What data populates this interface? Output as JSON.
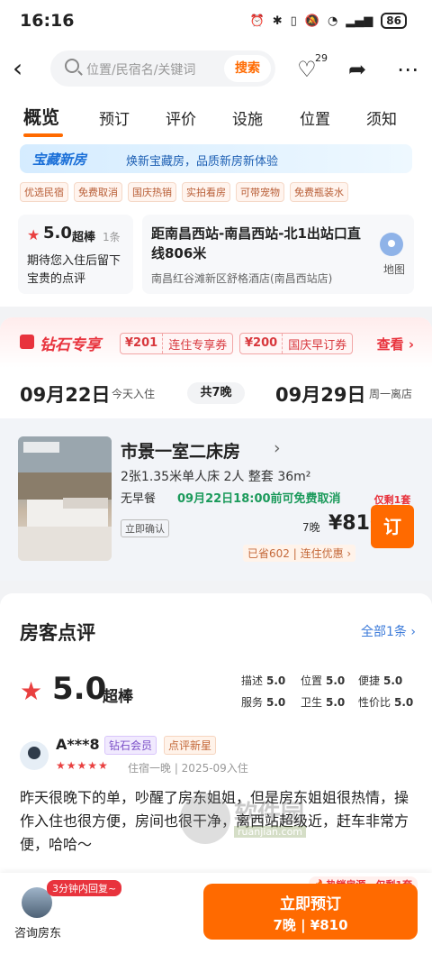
{
  "status_bar": {
    "time": "16:16",
    "battery": "86",
    "icons": [
      "alarm-icon",
      "bluetooth-icon",
      "vibrate-icon",
      "mute-icon",
      "wifi-icon",
      "signal-icon"
    ]
  },
  "header": {
    "search_placeholder": "位置/民宿名/关键词",
    "search_button": "搜索",
    "favorite_count": "29"
  },
  "tabs": [
    "概览",
    "预订",
    "评价",
    "设施",
    "位置",
    "须知"
  ],
  "promo": {
    "title": "宝藏新房",
    "subtitle": "焕新宝藏房，品质新房新体验"
  },
  "tags": [
    "优选民宿",
    "免费取消",
    "国庆热销",
    "实拍看房",
    "可带宠物",
    "免费瓶装水"
  ],
  "rating_card": {
    "score": "5.0",
    "label": "超棒",
    "count": "1条",
    "tip": "期待您入住后留下宝贵的点评"
  },
  "location_card": {
    "distance": "距南昌西站-南昌西站-北1出站口直线806米",
    "address": "南昌红谷滩新区舒格酒店(南昌西站店)",
    "map_label": "地图"
  },
  "diamond": {
    "title": "钻石专享",
    "coupons": [
      {
        "amount": "¥201",
        "name": "连住专享券"
      },
      {
        "amount": "¥200",
        "name": "国庆早订券"
      }
    ],
    "more": "查看"
  },
  "dates": {
    "checkin": "09月22日",
    "checkin_sub": "今天入住",
    "nights": "共7晚",
    "checkout": "09月29日",
    "checkout_sub": "周一离店"
  },
  "room": {
    "name": "市景一室二床房",
    "spec": "2张1.35米单人床 2人 整套 36m²",
    "breakfast": "无早餐",
    "cancel": "09月22日18:00前可免费取消",
    "confirm": "立即确认",
    "price_prefix": "7晚",
    "price": "¥810",
    "saved": "已省602 | 连住优惠",
    "remaining": "仅剩1套",
    "book": "订"
  },
  "reviews": {
    "heading": "房客点评",
    "all": "全部1条",
    "score": "5.0",
    "label": "超棒",
    "sub_scores": [
      {
        "name": "描述",
        "value": "5.0"
      },
      {
        "name": "位置",
        "value": "5.0"
      },
      {
        "name": "便捷",
        "value": "5.0"
      },
      {
        "name": "服务",
        "value": "5.0"
      },
      {
        "name": "卫生",
        "value": "5.0"
      },
      {
        "name": "性价比",
        "value": "5.0"
      }
    ],
    "item": {
      "user": "A***8",
      "badge1": "钻石会员",
      "badge2": "点评新星",
      "stars": 5,
      "stay": "住宿一晚 | 2025-09入住",
      "text": "昨天很晚下的单，吵醒了房东姐姐，但是房东姐姐很热情，操作入住也很方便，房间也很干净，离西站超级近，赶车非常方便，哈哈～"
    }
  },
  "watermark": {
    "text": "软件园",
    "url": "ruanjian.com"
  },
  "bottom": {
    "quick_reply": "3分钟内回复~",
    "consult": "咨询房东",
    "hot": "热销房源，仅剩1套",
    "cta_main": "立即预订",
    "cta_sub": "7晚 | ¥810"
  },
  "colors": {
    "accent": "#ff6a00",
    "red": "#e8333d",
    "link": "#3b7ad9",
    "green": "#1b9a5b"
  }
}
